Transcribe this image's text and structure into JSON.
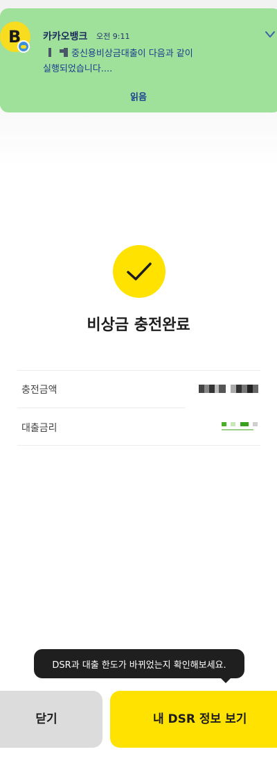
{
  "notification": {
    "app_icon_letter": "B",
    "app_name": "카카오뱅크",
    "time": "오전 9:11",
    "message_line1": "중신용비상금대출이 다음과 같이",
    "message_line2": "실행되었습니다....",
    "read_label": "읽음"
  },
  "result": {
    "title": "비상금 충전완료"
  },
  "details": [
    {
      "label": "충전금액"
    },
    {
      "label": "대출금리"
    }
  ],
  "tooltip": {
    "text": "DSR과 대출 한도가 바뀌었는지 확인해보세요."
  },
  "buttons": {
    "close_label": "닫기",
    "dsr_label": "내 DSR 정보 보기"
  },
  "colors": {
    "notification_bg": "#9fe09a",
    "accent_yellow": "#ffe200",
    "tooltip_bg": "#1f1f1f"
  }
}
